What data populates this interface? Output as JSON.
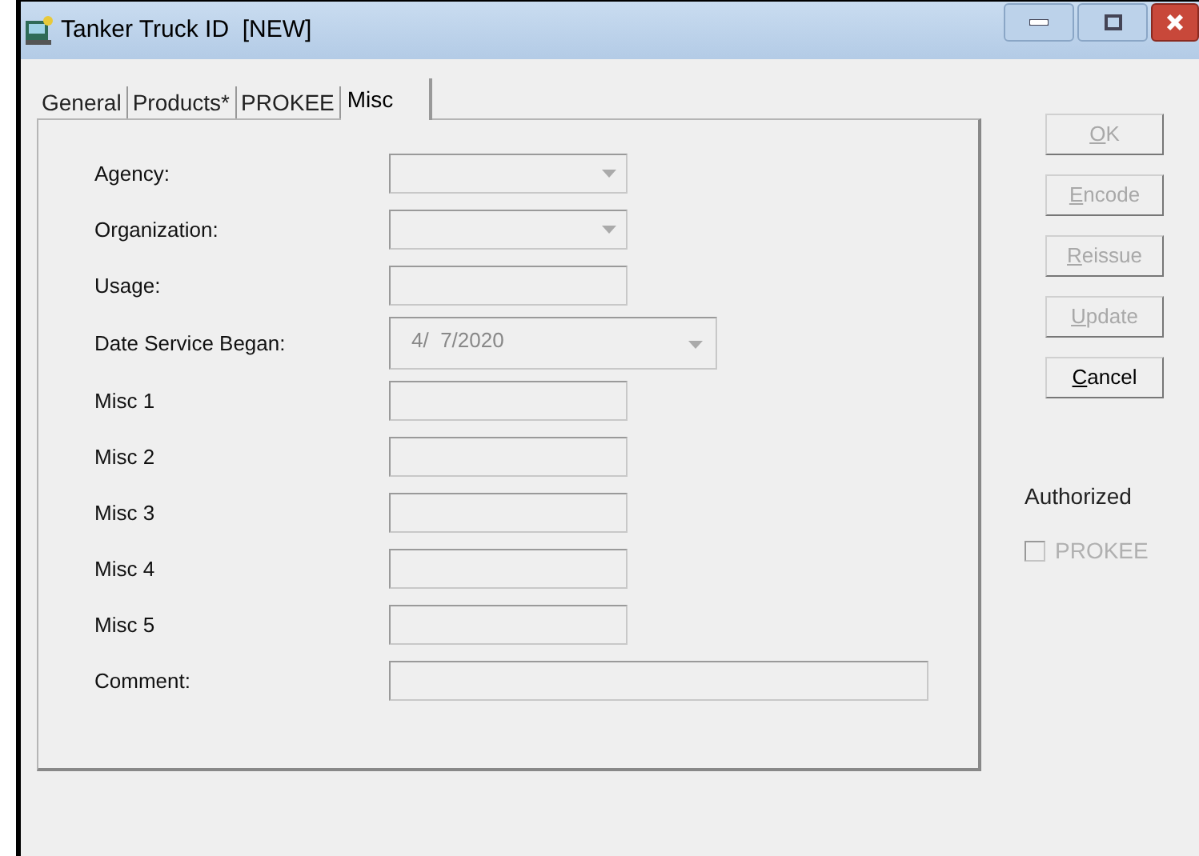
{
  "window": {
    "title": "Tanker Truck ID  [NEW]"
  },
  "tabs": [
    {
      "label": "General",
      "selected": false
    },
    {
      "label": "Products*",
      "selected": false
    },
    {
      "label": "PROKEE",
      "selected": false
    },
    {
      "label": "Misc",
      "selected": true
    }
  ],
  "fields": [
    {
      "label": "Agency:",
      "kind": "combo"
    },
    {
      "label": "Organization:",
      "kind": "combo"
    },
    {
      "label": "Usage:",
      "kind": "text"
    },
    {
      "label": "Date Service Began:",
      "kind": "date",
      "value": "4/  7/2020"
    },
    {
      "label": "Misc 1",
      "kind": "text"
    },
    {
      "label": "Misc 2",
      "kind": "text"
    },
    {
      "label": "Misc 3",
      "kind": "text"
    },
    {
      "label": "Misc 4",
      "kind": "text"
    },
    {
      "label": "Misc 5",
      "kind": "text"
    },
    {
      "label": "Comment:",
      "kind": "wide"
    }
  ],
  "buttons": [
    {
      "label": "OK",
      "first_letter_underlined": true,
      "disabled": true
    },
    {
      "label": "Encode",
      "first_letter_underlined": true,
      "disabled": true
    },
    {
      "label": "Reissue",
      "first_letter_underlined": true,
      "disabled": true
    },
    {
      "label": "Update",
      "first_letter_underlined": true,
      "disabled": true
    },
    {
      "label": "Cancel",
      "first_letter_underlined": true,
      "disabled": false
    }
  ],
  "authorized": {
    "heading": "Authorized",
    "checkbox": {
      "label": "PROKEE",
      "checked": false,
      "disabled": true
    }
  }
}
